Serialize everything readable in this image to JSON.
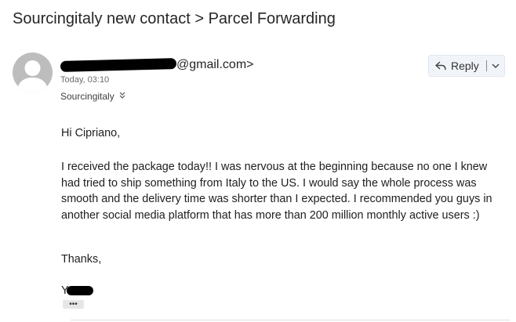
{
  "subject": "Sourcingitaly new contact > Parcel Forwarding",
  "sender": {
    "email_visible": "@gmail.com>",
    "timestamp": "Today, 03:10",
    "recipient": "Sourcingitaly",
    "recipient_expand_icon": "double-chevron-down-icon"
  },
  "toolbar": {
    "reply_label": "Reply",
    "reply_icon": "reply-arrow-icon",
    "dropdown_icon": "chevron-down-icon"
  },
  "message": {
    "greeting": "Hi Cipriano,",
    "paragraph": "I received the package today!! I was nervous at the beginning because no one I knew had tried to ship something from Italy to the US. I would say the whole process was smooth and the delivery time was shorter than I expected. I recommended you guys in another social media platform that has more than 200 million monthly active users :)",
    "closing": "Thanks,",
    "signature_initial": "Y",
    "more_label": "•••"
  },
  "colors": {
    "avatar_bg": "#bdbdbd",
    "reply_bg": "#f1f4f8",
    "text": "#202020",
    "redaction": "#000000"
  }
}
